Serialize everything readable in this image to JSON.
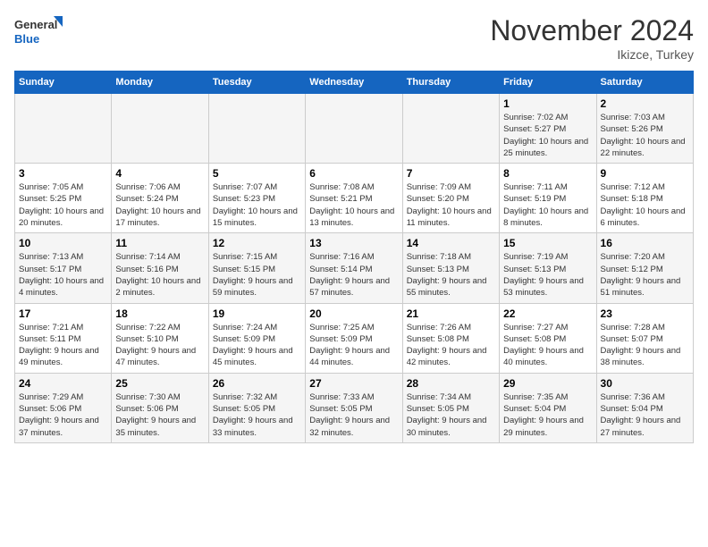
{
  "header": {
    "logo_line1": "General",
    "logo_line2": "Blue",
    "month_title": "November 2024",
    "location": "Ikizce, Turkey"
  },
  "days_of_week": [
    "Sunday",
    "Monday",
    "Tuesday",
    "Wednesday",
    "Thursday",
    "Friday",
    "Saturday"
  ],
  "weeks": [
    [
      {
        "day": "",
        "info": ""
      },
      {
        "day": "",
        "info": ""
      },
      {
        "day": "",
        "info": ""
      },
      {
        "day": "",
        "info": ""
      },
      {
        "day": "",
        "info": ""
      },
      {
        "day": "1",
        "info": "Sunrise: 7:02 AM\nSunset: 5:27 PM\nDaylight: 10 hours and 25 minutes."
      },
      {
        "day": "2",
        "info": "Sunrise: 7:03 AM\nSunset: 5:26 PM\nDaylight: 10 hours and 22 minutes."
      }
    ],
    [
      {
        "day": "3",
        "info": "Sunrise: 7:05 AM\nSunset: 5:25 PM\nDaylight: 10 hours and 20 minutes."
      },
      {
        "day": "4",
        "info": "Sunrise: 7:06 AM\nSunset: 5:24 PM\nDaylight: 10 hours and 17 minutes."
      },
      {
        "day": "5",
        "info": "Sunrise: 7:07 AM\nSunset: 5:23 PM\nDaylight: 10 hours and 15 minutes."
      },
      {
        "day": "6",
        "info": "Sunrise: 7:08 AM\nSunset: 5:21 PM\nDaylight: 10 hours and 13 minutes."
      },
      {
        "day": "7",
        "info": "Sunrise: 7:09 AM\nSunset: 5:20 PM\nDaylight: 10 hours and 11 minutes."
      },
      {
        "day": "8",
        "info": "Sunrise: 7:11 AM\nSunset: 5:19 PM\nDaylight: 10 hours and 8 minutes."
      },
      {
        "day": "9",
        "info": "Sunrise: 7:12 AM\nSunset: 5:18 PM\nDaylight: 10 hours and 6 minutes."
      }
    ],
    [
      {
        "day": "10",
        "info": "Sunrise: 7:13 AM\nSunset: 5:17 PM\nDaylight: 10 hours and 4 minutes."
      },
      {
        "day": "11",
        "info": "Sunrise: 7:14 AM\nSunset: 5:16 PM\nDaylight: 10 hours and 2 minutes."
      },
      {
        "day": "12",
        "info": "Sunrise: 7:15 AM\nSunset: 5:15 PM\nDaylight: 9 hours and 59 minutes."
      },
      {
        "day": "13",
        "info": "Sunrise: 7:16 AM\nSunset: 5:14 PM\nDaylight: 9 hours and 57 minutes."
      },
      {
        "day": "14",
        "info": "Sunrise: 7:18 AM\nSunset: 5:13 PM\nDaylight: 9 hours and 55 minutes."
      },
      {
        "day": "15",
        "info": "Sunrise: 7:19 AM\nSunset: 5:13 PM\nDaylight: 9 hours and 53 minutes."
      },
      {
        "day": "16",
        "info": "Sunrise: 7:20 AM\nSunset: 5:12 PM\nDaylight: 9 hours and 51 minutes."
      }
    ],
    [
      {
        "day": "17",
        "info": "Sunrise: 7:21 AM\nSunset: 5:11 PM\nDaylight: 9 hours and 49 minutes."
      },
      {
        "day": "18",
        "info": "Sunrise: 7:22 AM\nSunset: 5:10 PM\nDaylight: 9 hours and 47 minutes."
      },
      {
        "day": "19",
        "info": "Sunrise: 7:24 AM\nSunset: 5:09 PM\nDaylight: 9 hours and 45 minutes."
      },
      {
        "day": "20",
        "info": "Sunrise: 7:25 AM\nSunset: 5:09 PM\nDaylight: 9 hours and 44 minutes."
      },
      {
        "day": "21",
        "info": "Sunrise: 7:26 AM\nSunset: 5:08 PM\nDaylight: 9 hours and 42 minutes."
      },
      {
        "day": "22",
        "info": "Sunrise: 7:27 AM\nSunset: 5:08 PM\nDaylight: 9 hours and 40 minutes."
      },
      {
        "day": "23",
        "info": "Sunrise: 7:28 AM\nSunset: 5:07 PM\nDaylight: 9 hours and 38 minutes."
      }
    ],
    [
      {
        "day": "24",
        "info": "Sunrise: 7:29 AM\nSunset: 5:06 PM\nDaylight: 9 hours and 37 minutes."
      },
      {
        "day": "25",
        "info": "Sunrise: 7:30 AM\nSunset: 5:06 PM\nDaylight: 9 hours and 35 minutes."
      },
      {
        "day": "26",
        "info": "Sunrise: 7:32 AM\nSunset: 5:05 PM\nDaylight: 9 hours and 33 minutes."
      },
      {
        "day": "27",
        "info": "Sunrise: 7:33 AM\nSunset: 5:05 PM\nDaylight: 9 hours and 32 minutes."
      },
      {
        "day": "28",
        "info": "Sunrise: 7:34 AM\nSunset: 5:05 PM\nDaylight: 9 hours and 30 minutes."
      },
      {
        "day": "29",
        "info": "Sunrise: 7:35 AM\nSunset: 5:04 PM\nDaylight: 9 hours and 29 minutes."
      },
      {
        "day": "30",
        "info": "Sunrise: 7:36 AM\nSunset: 5:04 PM\nDaylight: 9 hours and 27 minutes."
      }
    ]
  ]
}
